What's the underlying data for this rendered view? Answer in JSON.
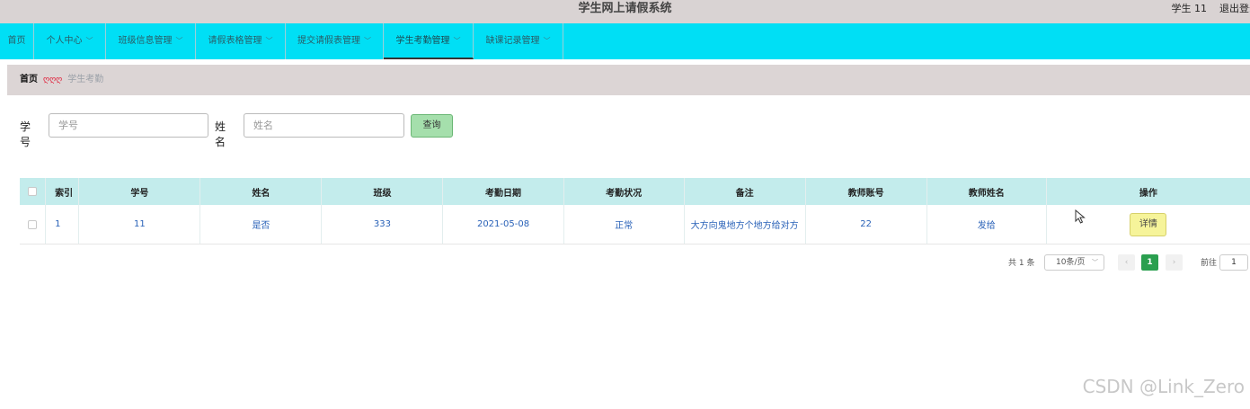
{
  "app": {
    "title": "学生网上请假系统",
    "user_label": "学生 11",
    "logout_label": "退出登录"
  },
  "nav": {
    "items": [
      {
        "label": "首页",
        "has_arrow": false
      },
      {
        "label": "个人中心",
        "has_arrow": true
      },
      {
        "label": "班级信息管理",
        "has_arrow": true
      },
      {
        "label": "请假表格管理",
        "has_arrow": true
      },
      {
        "label": "提交请假表管理",
        "has_arrow": true
      },
      {
        "label": "学生考勤管理",
        "has_arrow": true
      },
      {
        "label": "缺课记录管理",
        "has_arrow": true
      }
    ],
    "arrow_glyph": "﹀"
  },
  "breadcrumb": {
    "home": "首页",
    "separator": "ღღღ",
    "current": "学生考勤"
  },
  "search": {
    "student_no_label": "学号",
    "student_no_placeholder": "学号",
    "name_label": "姓名",
    "name_placeholder": "姓名",
    "query_button": "查询"
  },
  "table": {
    "headers": [
      "索引",
      "学号",
      "姓名",
      "班级",
      "考勤日期",
      "考勤状况",
      "备注",
      "教师账号",
      "教师姓名",
      "操作"
    ],
    "rows": [
      {
        "index": "1",
        "student_no": "11",
        "name": "是否",
        "class": "333",
        "date": "2021-05-08",
        "status": "正常",
        "remark": "大方向鬼地方个地方给对方",
        "teacher_account": "22",
        "teacher_name": "发给",
        "action": "详情"
      }
    ]
  },
  "pagination": {
    "total": "共 1 条",
    "page_size": "10条/页",
    "prev": "‹",
    "current_page": "1",
    "next": "›",
    "goto_label": "前往",
    "goto_value": "1"
  },
  "watermark": "CSDN @Link_Zero",
  "colors": {
    "nav_bg": "#00dff5",
    "header_bg": "#d9d3d3",
    "table_head_bg": "#c3ecec",
    "query_btn": "#a5dfac",
    "detail_btn": "#f6f49a",
    "page_active": "#2a9f4f"
  }
}
